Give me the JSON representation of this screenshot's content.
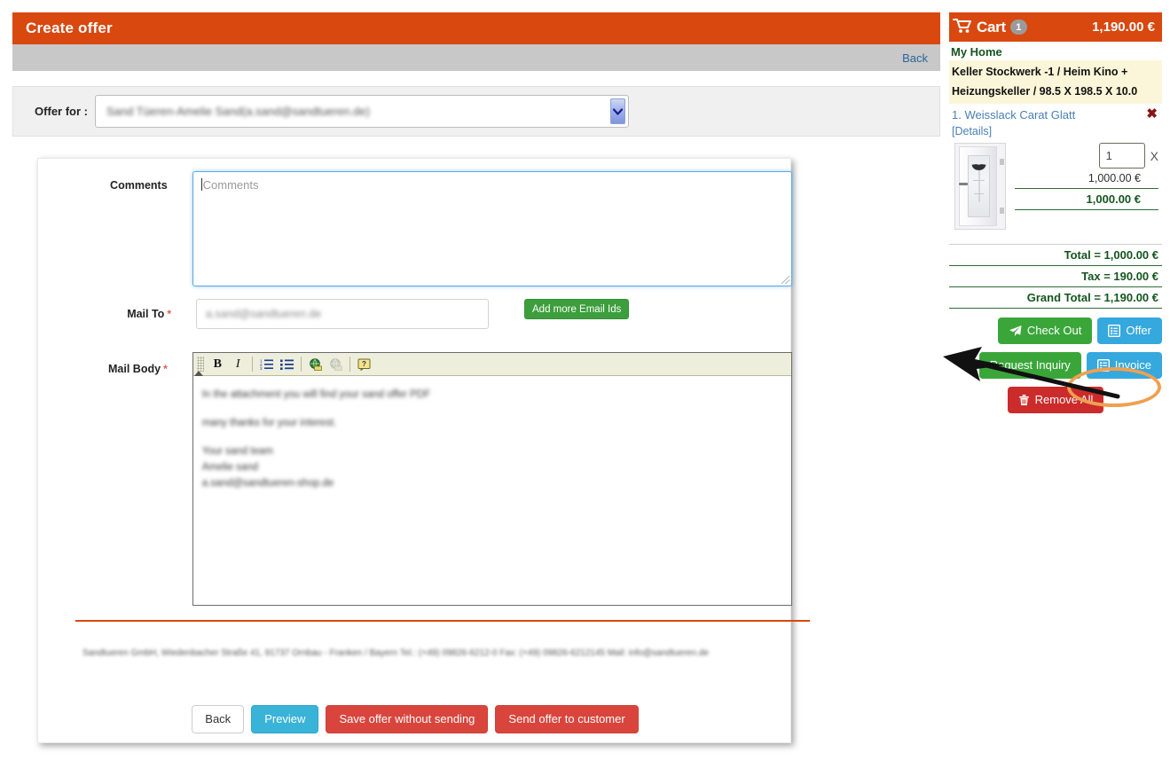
{
  "header": {
    "title": "Create offer",
    "accent_color": "#d9480f",
    "back_label": "Back"
  },
  "offer_for": {
    "label": "Offer for :",
    "selected_value": "Sand Tüeren-Amelie Sand(a.sand@sandtueren.de)",
    "dropdown_icon": "chevron-down-icon"
  },
  "form": {
    "comments": {
      "label": "Comments",
      "placeholder": "Comments",
      "value": ""
    },
    "mail_to": {
      "label": "Mail To",
      "required_marker": "*",
      "value": "a.sand@sandtueren.de",
      "add_more_label": "Add more Email Ids"
    },
    "mail_body": {
      "label": "Mail Body",
      "required_marker": "*",
      "toolbar": [
        {
          "name": "bold-icon",
          "glyph": "B"
        },
        {
          "name": "italic-icon",
          "glyph": "I"
        },
        {
          "name": "ordered-list-icon",
          "glyph": "list-ol"
        },
        {
          "name": "unordered-list-icon",
          "glyph": "list-ul"
        },
        {
          "name": "insert-link-icon",
          "glyph": "globe"
        },
        {
          "name": "unlink-icon",
          "glyph": "globe-muted"
        },
        {
          "name": "help-icon",
          "glyph": "?"
        }
      ],
      "lines": [
        "In the attachment you will find your sand offer PDF",
        "many thanks for your interest.",
        "Your sand team",
        "Amelie sand",
        "a.sand@sandtueren-shop.de"
      ]
    },
    "legal_footer": "Sandtueren GmbH, Wiedenbacher Straße 41, 91737 Ornbau - Franken / Bayern Tel.: (+49) 09826-6212-0 Fax: (+49) 09826-6212145 Mail: info@sandtueren.de",
    "actions": [
      {
        "name": "back-button",
        "label": "Back",
        "style": "default"
      },
      {
        "name": "preview-button",
        "label": "Preview",
        "style": "info"
      },
      {
        "name": "save-offer-button",
        "label": "Save offer without sending",
        "style": "danger"
      },
      {
        "name": "send-offer-button",
        "label": "Send offer to customer",
        "style": "danger"
      }
    ]
  },
  "cart": {
    "title": "Cart",
    "badge_count": "1",
    "header_total": "1,190.00 €",
    "home_label": "My Home",
    "location": "Keller Stockwerk -1 / Heim Kino + Heizungskeller / 98.5 X 198.5 X 10.0",
    "item": {
      "title": "1. Weisslack Carat Glatt",
      "details_label": "[Details]",
      "remove_icon": "remove-x-icon",
      "thumbnail_name": "door-product-thumbnail",
      "quantity": "1",
      "multiply_symbol": "X",
      "unit_price": "1,000.00 €",
      "line_total": "1,000.00 €"
    },
    "totals": [
      {
        "name": "cart-total-row",
        "label": "Total = 1,000.00 €"
      },
      {
        "name": "cart-tax-row",
        "label": "Tax = 190.00 €"
      },
      {
        "name": "cart-grand-total-row",
        "label": "Grand Total = 1,190.00 €"
      }
    ],
    "buttons": [
      {
        "name": "check-out-button",
        "label": "Check Out",
        "style": "green",
        "icon": "paper-plane-icon"
      },
      {
        "name": "offer-button",
        "label": "Offer",
        "style": "blue",
        "icon": "document-list-icon",
        "highlighted": true
      },
      {
        "name": "request-inquiry-button",
        "label": "Request Inquiry",
        "style": "green",
        "icon": "none"
      },
      {
        "name": "invoice-button",
        "label": "Invoice",
        "style": "blue",
        "icon": "document-list-icon"
      },
      {
        "name": "remove-all-button",
        "label": "Remove All",
        "style": "red",
        "icon": "trash-icon"
      }
    ]
  },
  "annotation": {
    "arrow_name": "pointer-arrow-annotation",
    "highlight_name": "offer-button-highlight-ellipse",
    "highlight_color": "#f0a050"
  }
}
